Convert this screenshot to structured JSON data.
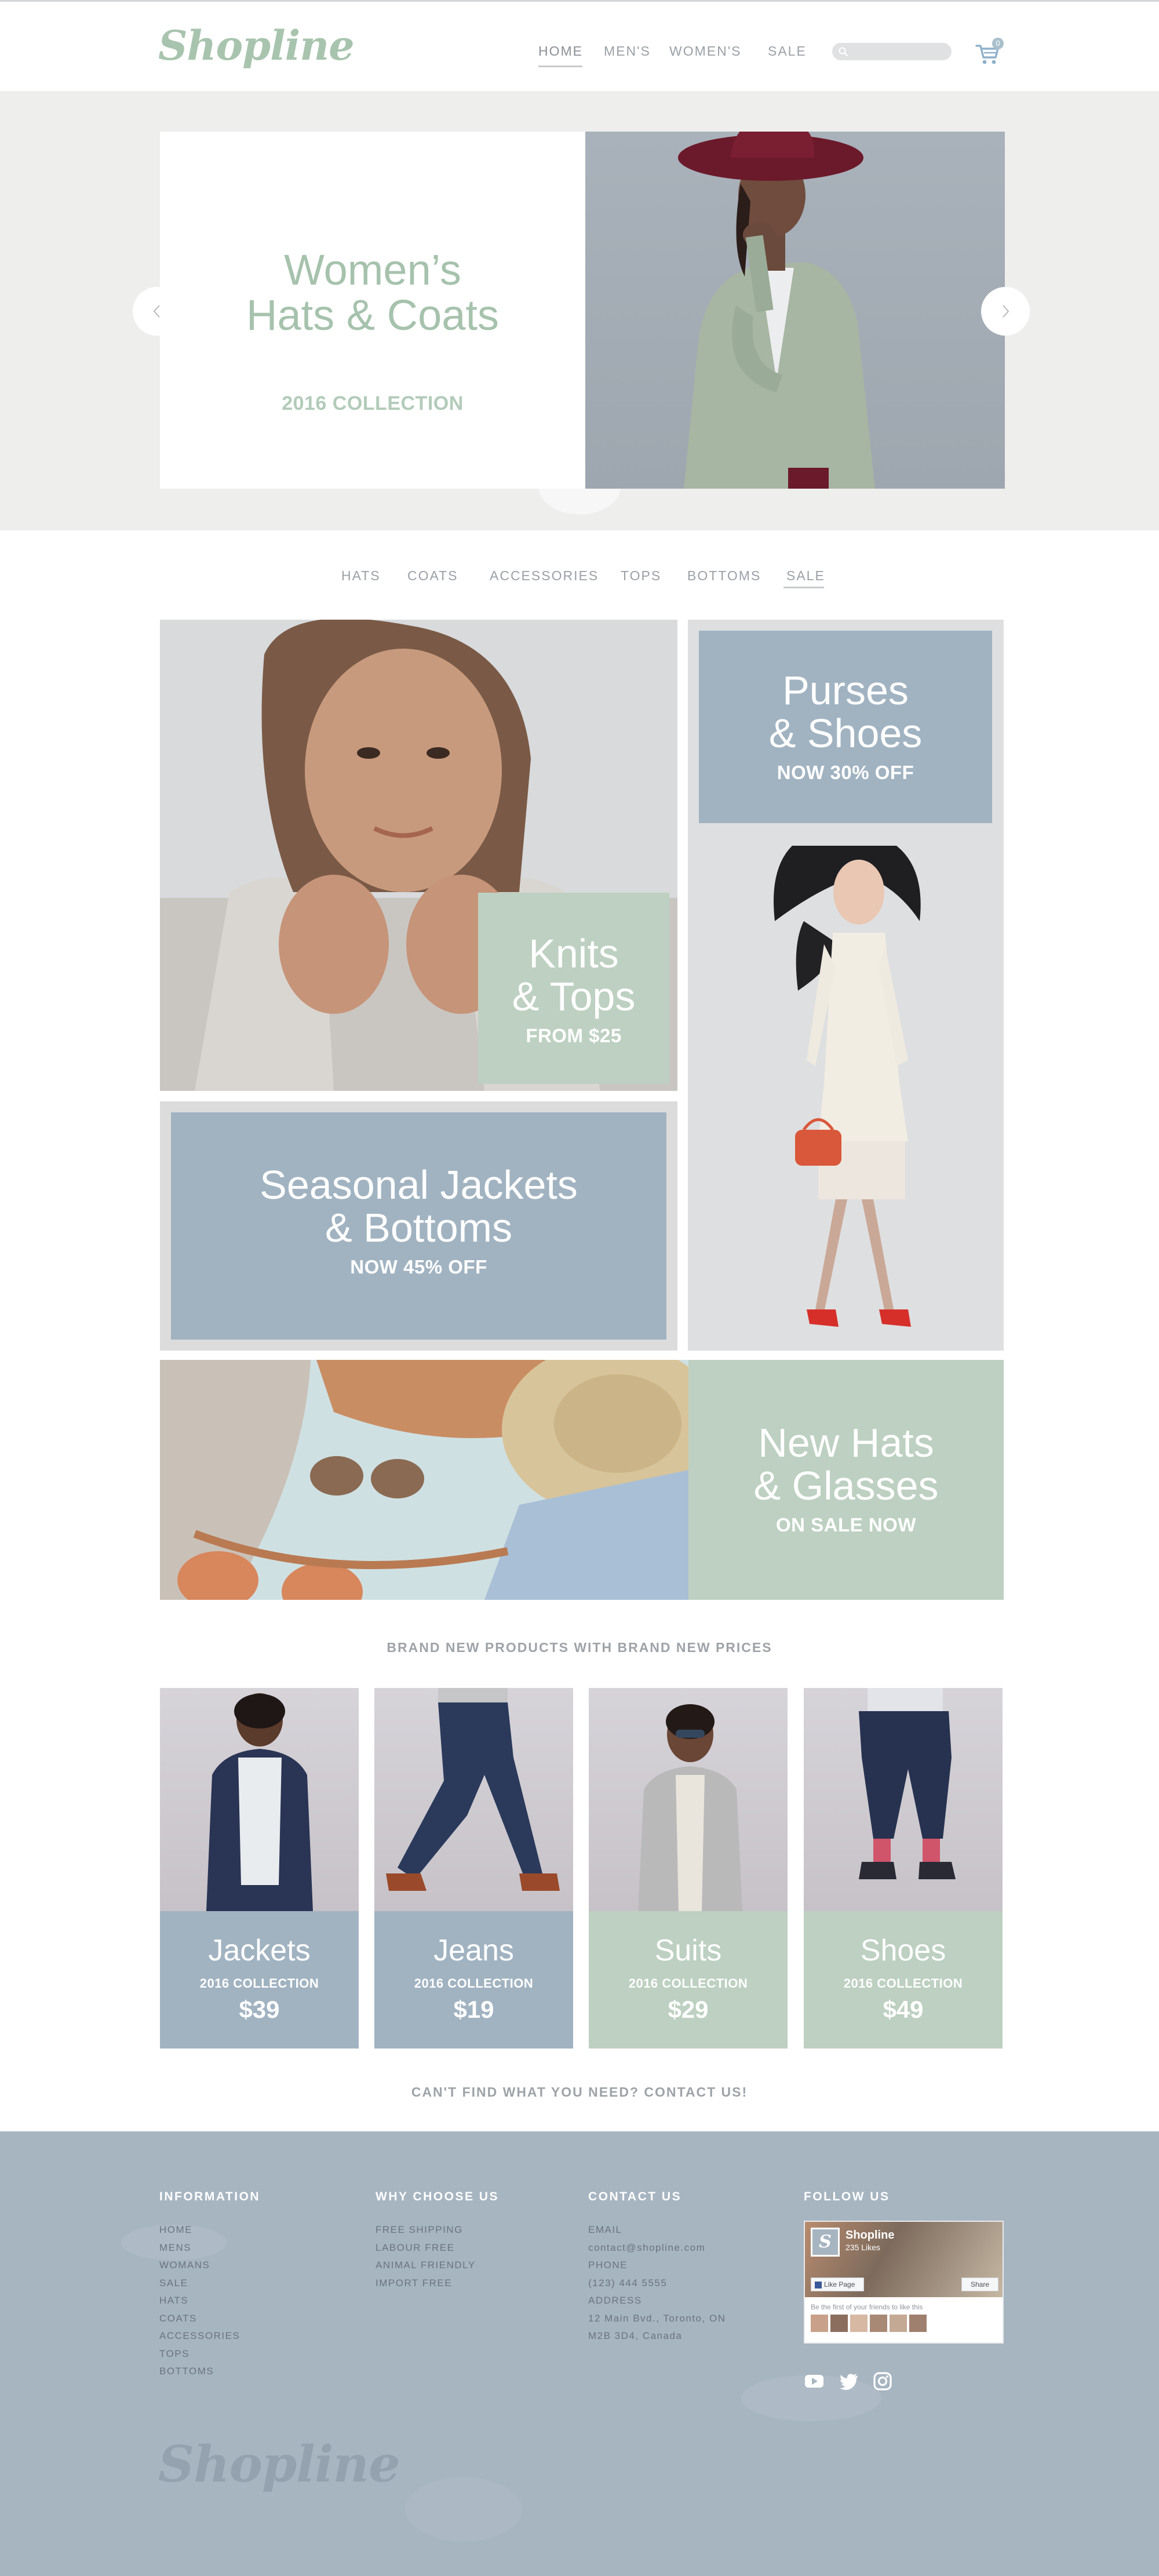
{
  "brand": {
    "logo_text": "Shopline"
  },
  "header": {
    "nav": [
      "HOME",
      "MEN'S",
      "WOMEN'S",
      "SALE"
    ],
    "search_placeholder": "",
    "cart_count": "0",
    "cart_icon": "shopping-cart-icon"
  },
  "hero": {
    "title_line1": "Women’s",
    "title_line2": "Hats & Coats",
    "subtitle": "2016 COLLECTION",
    "prev_icon": "chevron-left-icon",
    "next_icon": "chevron-right-icon"
  },
  "categories": [
    "HATS",
    "COATS",
    "ACCESSORIES",
    "TOPS",
    "BOTTOMS",
    "SALE"
  ],
  "promos": {
    "knits": {
      "line1": "Knits",
      "line2": "& Tops",
      "sub": "FROM $25"
    },
    "purses": {
      "line1": "Purses",
      "line2": "& Shoes",
      "sub": "NOW 30% OFF"
    },
    "jackets": {
      "line1": "Seasonal Jackets",
      "line2": "& Bottoms",
      "sub": "NOW 45% OFF"
    },
    "hats": {
      "line1": "New Hats",
      "line2": "& Glasses",
      "sub": "ON SALE NOW"
    }
  },
  "products_heading": "BRAND NEW PRODUCTS WITH BRAND NEW PRICES",
  "products": [
    {
      "name": "Jackets",
      "collection": "2016 COLLECTION",
      "price": "$39"
    },
    {
      "name": "Jeans",
      "collection": "2016 COLLECTION",
      "price": "$19"
    },
    {
      "name": "Suits",
      "collection": "2016 COLLECTION",
      "price": "$29"
    },
    {
      "name": "Shoes",
      "collection": "2016 COLLECTION",
      "price": "$49"
    }
  ],
  "contact_cta": "CAN'T FIND WHAT YOU NEED? CONTACT US!",
  "footer": {
    "information": {
      "heading": "INFORMATION",
      "links": [
        "HOME",
        "MENS",
        "WOMANS",
        "SALE",
        "HATS",
        "COATS",
        "ACCESSORIES",
        "TOPS",
        "BOTTOMS"
      ]
    },
    "why": {
      "heading": "WHY CHOOSE US",
      "links": [
        "FREE SHIPPING",
        "LABOUR FREE",
        "ANIMAL FRIENDLY",
        "IMPORT FREE"
      ]
    },
    "contact": {
      "heading": "CONTACT US",
      "lines": [
        "EMAIL",
        "contact@shopline.com",
        "PHONE",
        "(123) 444 5555",
        "ADDRESS",
        "12 Main Bvd., Toronto, ON",
        "M2B 3D4, Canada"
      ]
    },
    "follow": {
      "heading": "FOLLOW US",
      "fb_name": "Shopline",
      "fb_likes": "235 Likes",
      "fb_like_label": "Like Page",
      "fb_share_label": "Share",
      "fb_friends_text": "Be the first of your friends to like this",
      "social_icons": [
        "youtube-icon",
        "twitter-icon",
        "instagram-icon"
      ]
    },
    "logo_text": "Shopline"
  },
  "colors": {
    "brand_green": "#a8c4ae",
    "promo_blue": "#a1b3c1",
    "promo_green": "#bdd0c1",
    "footer_blue": "#a7b5c1"
  }
}
